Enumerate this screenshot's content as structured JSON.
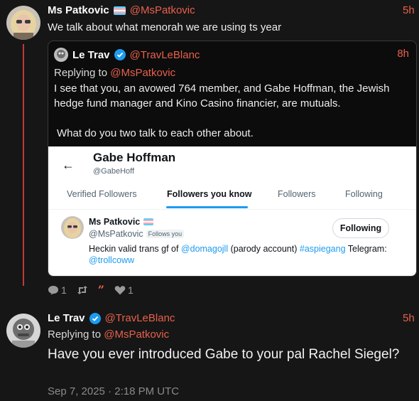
{
  "tweet1": {
    "display_name": "Ms Patkovic",
    "handle": "@MsPatkovic",
    "time": "5h",
    "text": "We talk about what menorah we are using ts year"
  },
  "quote": {
    "display_name": "Le Trav",
    "handle": "@TravLeBlanc",
    "time": "8h",
    "replying_prefix": "Replying to ",
    "replying_to": "@MsPatkovic",
    "paragraph1": "I see that you, an avowed 764 member, and Gabe Hoffman, the Jewish hedge fund manager and Kino Casino financier, are mutuals.",
    "paragraph2": "What do you two talk to each other about.",
    "embed": {
      "title": "Gabe Hoffman",
      "subtitle": "@GabeHoff",
      "tabs": [
        "Verified Followers",
        "Followers you know",
        "Followers",
        "Following"
      ],
      "active_tab": "Followers you know",
      "user_name": "Ms Patkovic",
      "user_handle": "@MsPatkovic",
      "follows_you": "Follows you",
      "follow_button": "Following",
      "bio_prefix": "Heckin valid trans gf of ",
      "bio_link1": "@domagojll",
      "bio_middle": " (parody account) ",
      "bio_link2": "#aspiegang",
      "bio_suffix": " Telegram: ",
      "bio_link3": "@trollcoww"
    }
  },
  "actions": {
    "reply_count": "1",
    "like_count": "1"
  },
  "tweet2": {
    "display_name": "Le Trav",
    "handle": "@TravLeBlanc",
    "time": "5h",
    "replying_prefix": "Replying to ",
    "replying_to": "@MsPatkovic",
    "text": "Have you ever introduced Gabe to your pal Rachel Siegel?",
    "date": "Sep 7, 2025 · 2:18 PM UTC"
  },
  "colors": {
    "background": "#161616",
    "accent": "#e8604c",
    "verified": "#1d9bf0",
    "thread_line": "#c23a3a"
  }
}
